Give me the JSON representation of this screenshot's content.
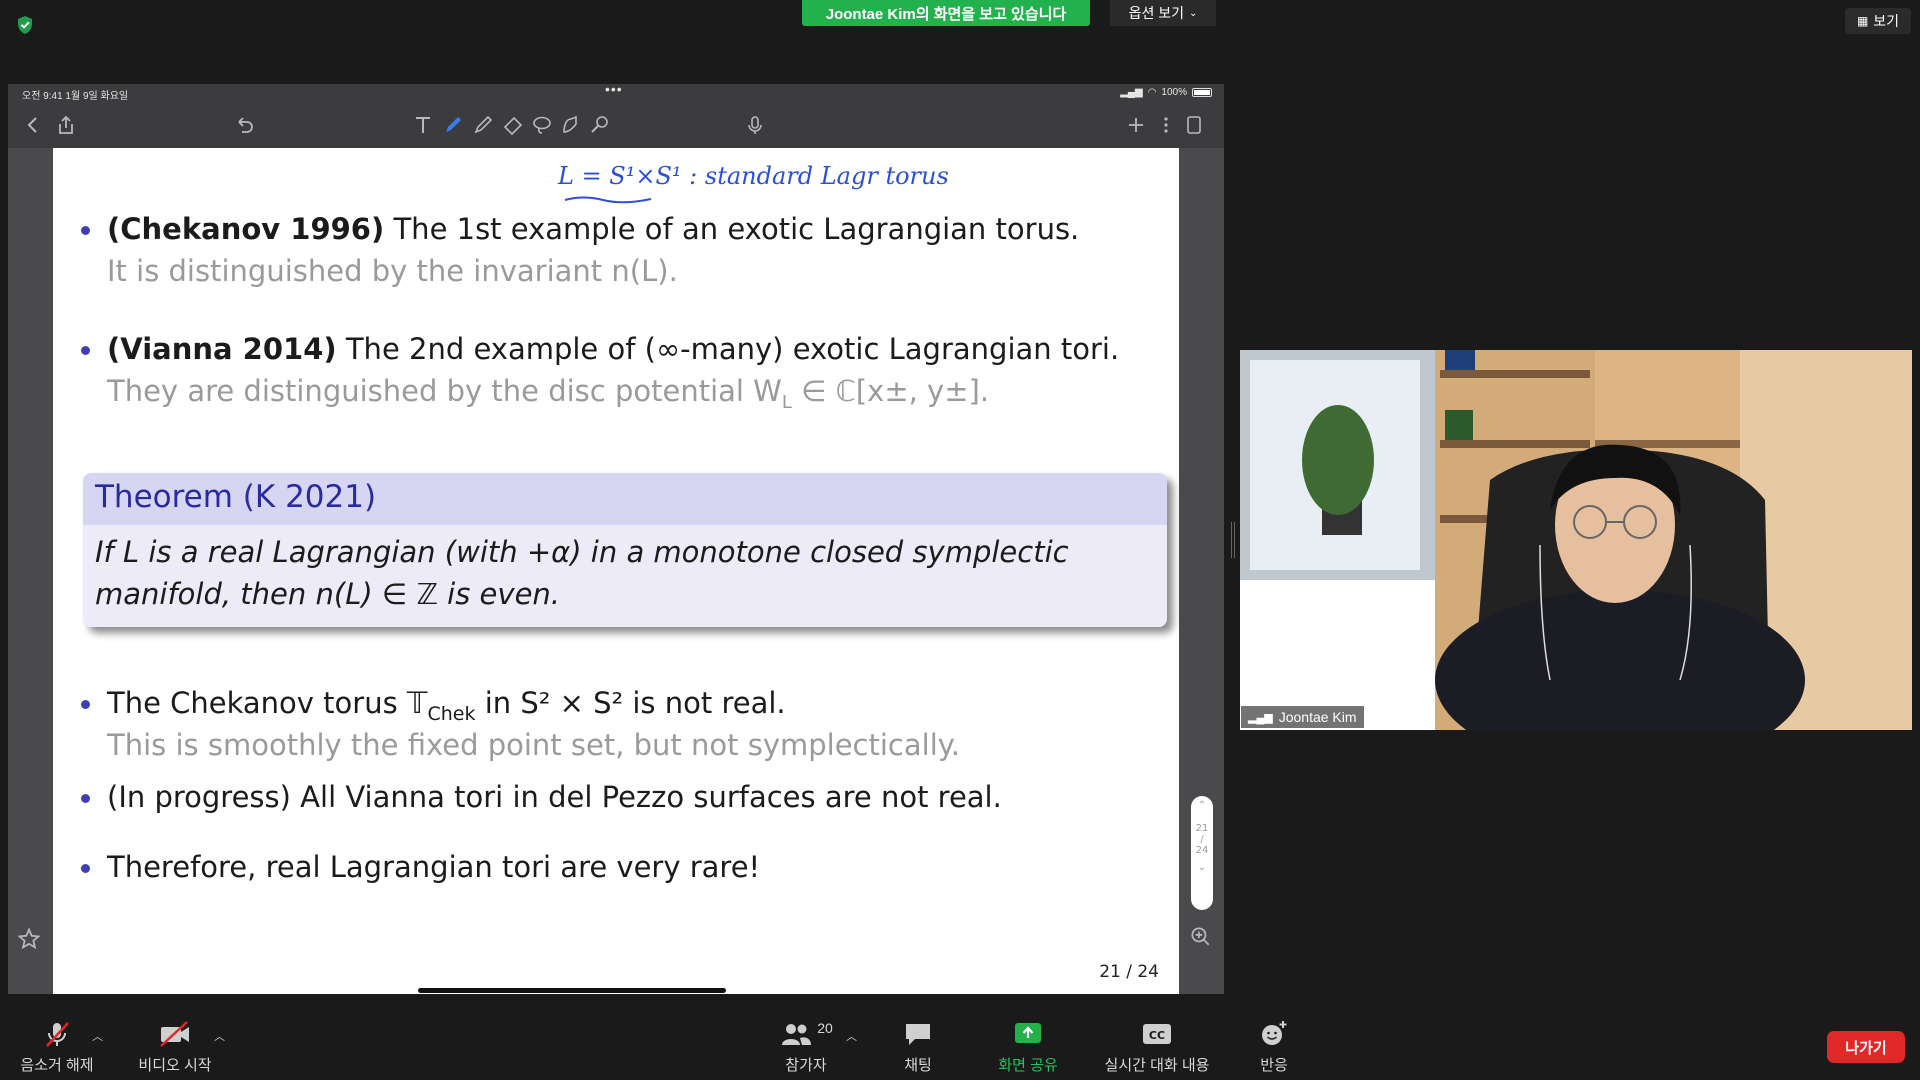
{
  "top": {
    "share_banner": "Joontae Kim의 화면을 보고 있습니다",
    "view_options": "옵션 보기",
    "view_button": "보기"
  },
  "ipad_status": {
    "time_date": "오전 9:41  1월 9일 화요일",
    "battery": "100%"
  },
  "slide": {
    "handwritten_note": "L = S¹×S¹ : standard Lagr torus",
    "bullet1_bold": "(Chekanov 1996)",
    "bullet1_text": " The 1st example of an exotic Lagrangian torus.",
    "bullet1_sub": "It is distinguished by the invariant n(L).",
    "bullet2_bold": "(Vianna 2014)",
    "bullet2_text": " The 2nd example of (∞-many) exotic Lagrangian tori.",
    "bullet2_sub": "They are distinguished by the disc potential W",
    "bullet2_sub_sub": "L",
    "bullet2_sub_tail": " ∈ ℂ[x±, y±].",
    "theorem_title": "Theorem (K 2021)",
    "theorem_line1": "If L is a real Lagrangian (with +α) in a monotone closed symplectic",
    "theorem_line2": "manifold, then n(L) ∈ ℤ is even.",
    "bullet3_text_a": "The Chekanov torus 𝕋",
    "bullet3_sub": "Chek",
    "bullet3_text_b": " in S² × S² is not real.",
    "bullet3_gray": "This is smoothly the fixed point set, but not symplectically.",
    "bullet4_text": "(In progress) All Vianna tori in del Pezzo surfaces are not real.",
    "bullet5_text": "Therefore, real Lagrangian tori are very rare!",
    "page_number": "21 / 24"
  },
  "scroll_pill": {
    "top": "21",
    "bottom": "24"
  },
  "video": {
    "participant_name": "Joontae Kim"
  },
  "bottom": {
    "unmute": "음소거 해제",
    "start_video": "비디오 시작",
    "participants": "참가자",
    "participants_count": "20",
    "chat": "채팅",
    "share_screen": "화면 공유",
    "live_transcript": "실시간 대화 내용",
    "reactions": "반응",
    "leave": "나가기"
  },
  "colors": {
    "share_banner_bg": "#22b14c",
    "theorem_head_bg": "#d7d6f2",
    "leave_bg": "#e02828"
  }
}
